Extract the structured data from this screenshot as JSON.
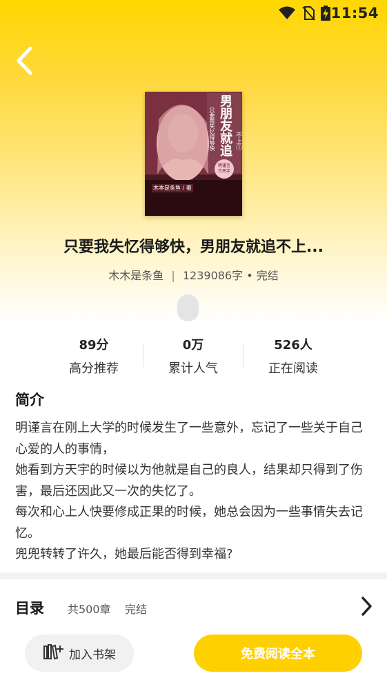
{
  "status_bar": {
    "time": "11:54",
    "icons": [
      "wifi-icon",
      "no-sim-icon",
      "battery-charging-icon"
    ]
  },
  "nav": {
    "back_icon": "chevron-left-icon"
  },
  "book": {
    "cover_title": "男朋友就追",
    "cover_volume": "不上①",
    "cover_subtitle": "只要我失忆得够快",
    "cover_badge": [
      "明谨言",
      "方天宇"
    ],
    "cover_author": "木本是条鱼 / 著",
    "title": "只要我失忆得够快，男朋友就追不上...",
    "author": "木木是条鱼",
    "separator": "|",
    "word_count": "1239086字",
    "dot": "•",
    "status": "完结"
  },
  "stats": [
    {
      "value": "89分",
      "label": "高分推荐"
    },
    {
      "value": "0万",
      "label": "累计人气"
    },
    {
      "value": "526人",
      "label": "正在阅读"
    }
  ],
  "intro": {
    "heading": "简介",
    "paragraphs": [
      "明谨言在刚上大学的时候发生了一些意外，忘记了一些关于自己心爱的人的事情，",
      "她看到方天宇的时候以为他就是自己的良人，结果却只得到了伤害，最后还因此又一次的失忆了。",
      "每次和心上人快要修成正果的时候，她总会因为一些事情失去记忆。",
      "兜兜转转了许久，她最后能否得到幸福?"
    ]
  },
  "toc": {
    "title": "目录",
    "count": "共500章",
    "status": "完结",
    "chevron_icon": "chevron-right-icon"
  },
  "actions": {
    "shelf_label": "加入书架",
    "shelf_icon": "bookshelf-add-icon",
    "read_label": "免费阅读全本"
  },
  "colors": {
    "accent": "#ffd000",
    "hero_top": "#ffd700"
  }
}
